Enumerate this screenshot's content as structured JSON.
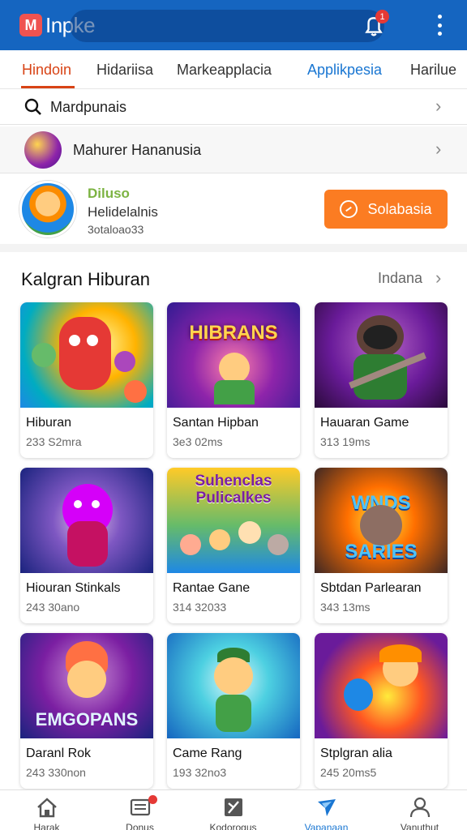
{
  "app": {
    "logo_letter": "M",
    "title": "Inpke",
    "notification_count": "1",
    "brand_color": "#1565c0"
  },
  "tabs": [
    {
      "label": "Hindoin"
    },
    {
      "label": "Hidariisa"
    },
    {
      "label": "Markeapplacia"
    },
    {
      "label": "Applikpesia"
    },
    {
      "label": "Harilue"
    }
  ],
  "search": {
    "text": "Mardpunais"
  },
  "feature": {
    "text": "Mahurer Hananusia"
  },
  "profile": {
    "name": "Diluso",
    "subtitle": "Helidelalnis",
    "meta": "3otaloao33",
    "button_label": "Solabasia",
    "button_color": "#fb7c22"
  },
  "section": {
    "title": "Kalgran Hiburan",
    "more_label": "Indana"
  },
  "cards": [
    {
      "title": "Hiburan",
      "meta": "233 S2mra",
      "art_text": ""
    },
    {
      "title": "Santan Hipban",
      "meta": "3e3 02ms",
      "art_text": "HIBRANS"
    },
    {
      "title": "Hauaran Game",
      "meta": "313 19ms",
      "art_text": ""
    },
    {
      "title": "Hiouran Stinkals",
      "meta": "243 30ano",
      "art_text": ""
    },
    {
      "title": "Rantae Gane",
      "meta": "314 32033",
      "art_text": "Suhenclas Pulicalkes"
    },
    {
      "title": "Sbtdan Parlearan",
      "meta": "343 13ms",
      "art_text": "WNDS SARIES"
    },
    {
      "title": "Daranl Rok",
      "meta": "243 330non",
      "art_text": "EMGOPANS"
    },
    {
      "title": "Came Rang",
      "meta": "193 32no3",
      "art_text": ""
    },
    {
      "title": "Stplgran alia",
      "meta": "245 20ms5",
      "art_text": ""
    }
  ],
  "bottom_nav": [
    {
      "label": "Harak",
      "icon": "home-icon"
    },
    {
      "label": "Donus",
      "icon": "news-icon"
    },
    {
      "label": "Kodorogus",
      "icon": "tools-icon"
    },
    {
      "label": "Vapanaan",
      "icon": "send-icon"
    },
    {
      "label": "Vanuthut",
      "icon": "profile-icon"
    }
  ]
}
